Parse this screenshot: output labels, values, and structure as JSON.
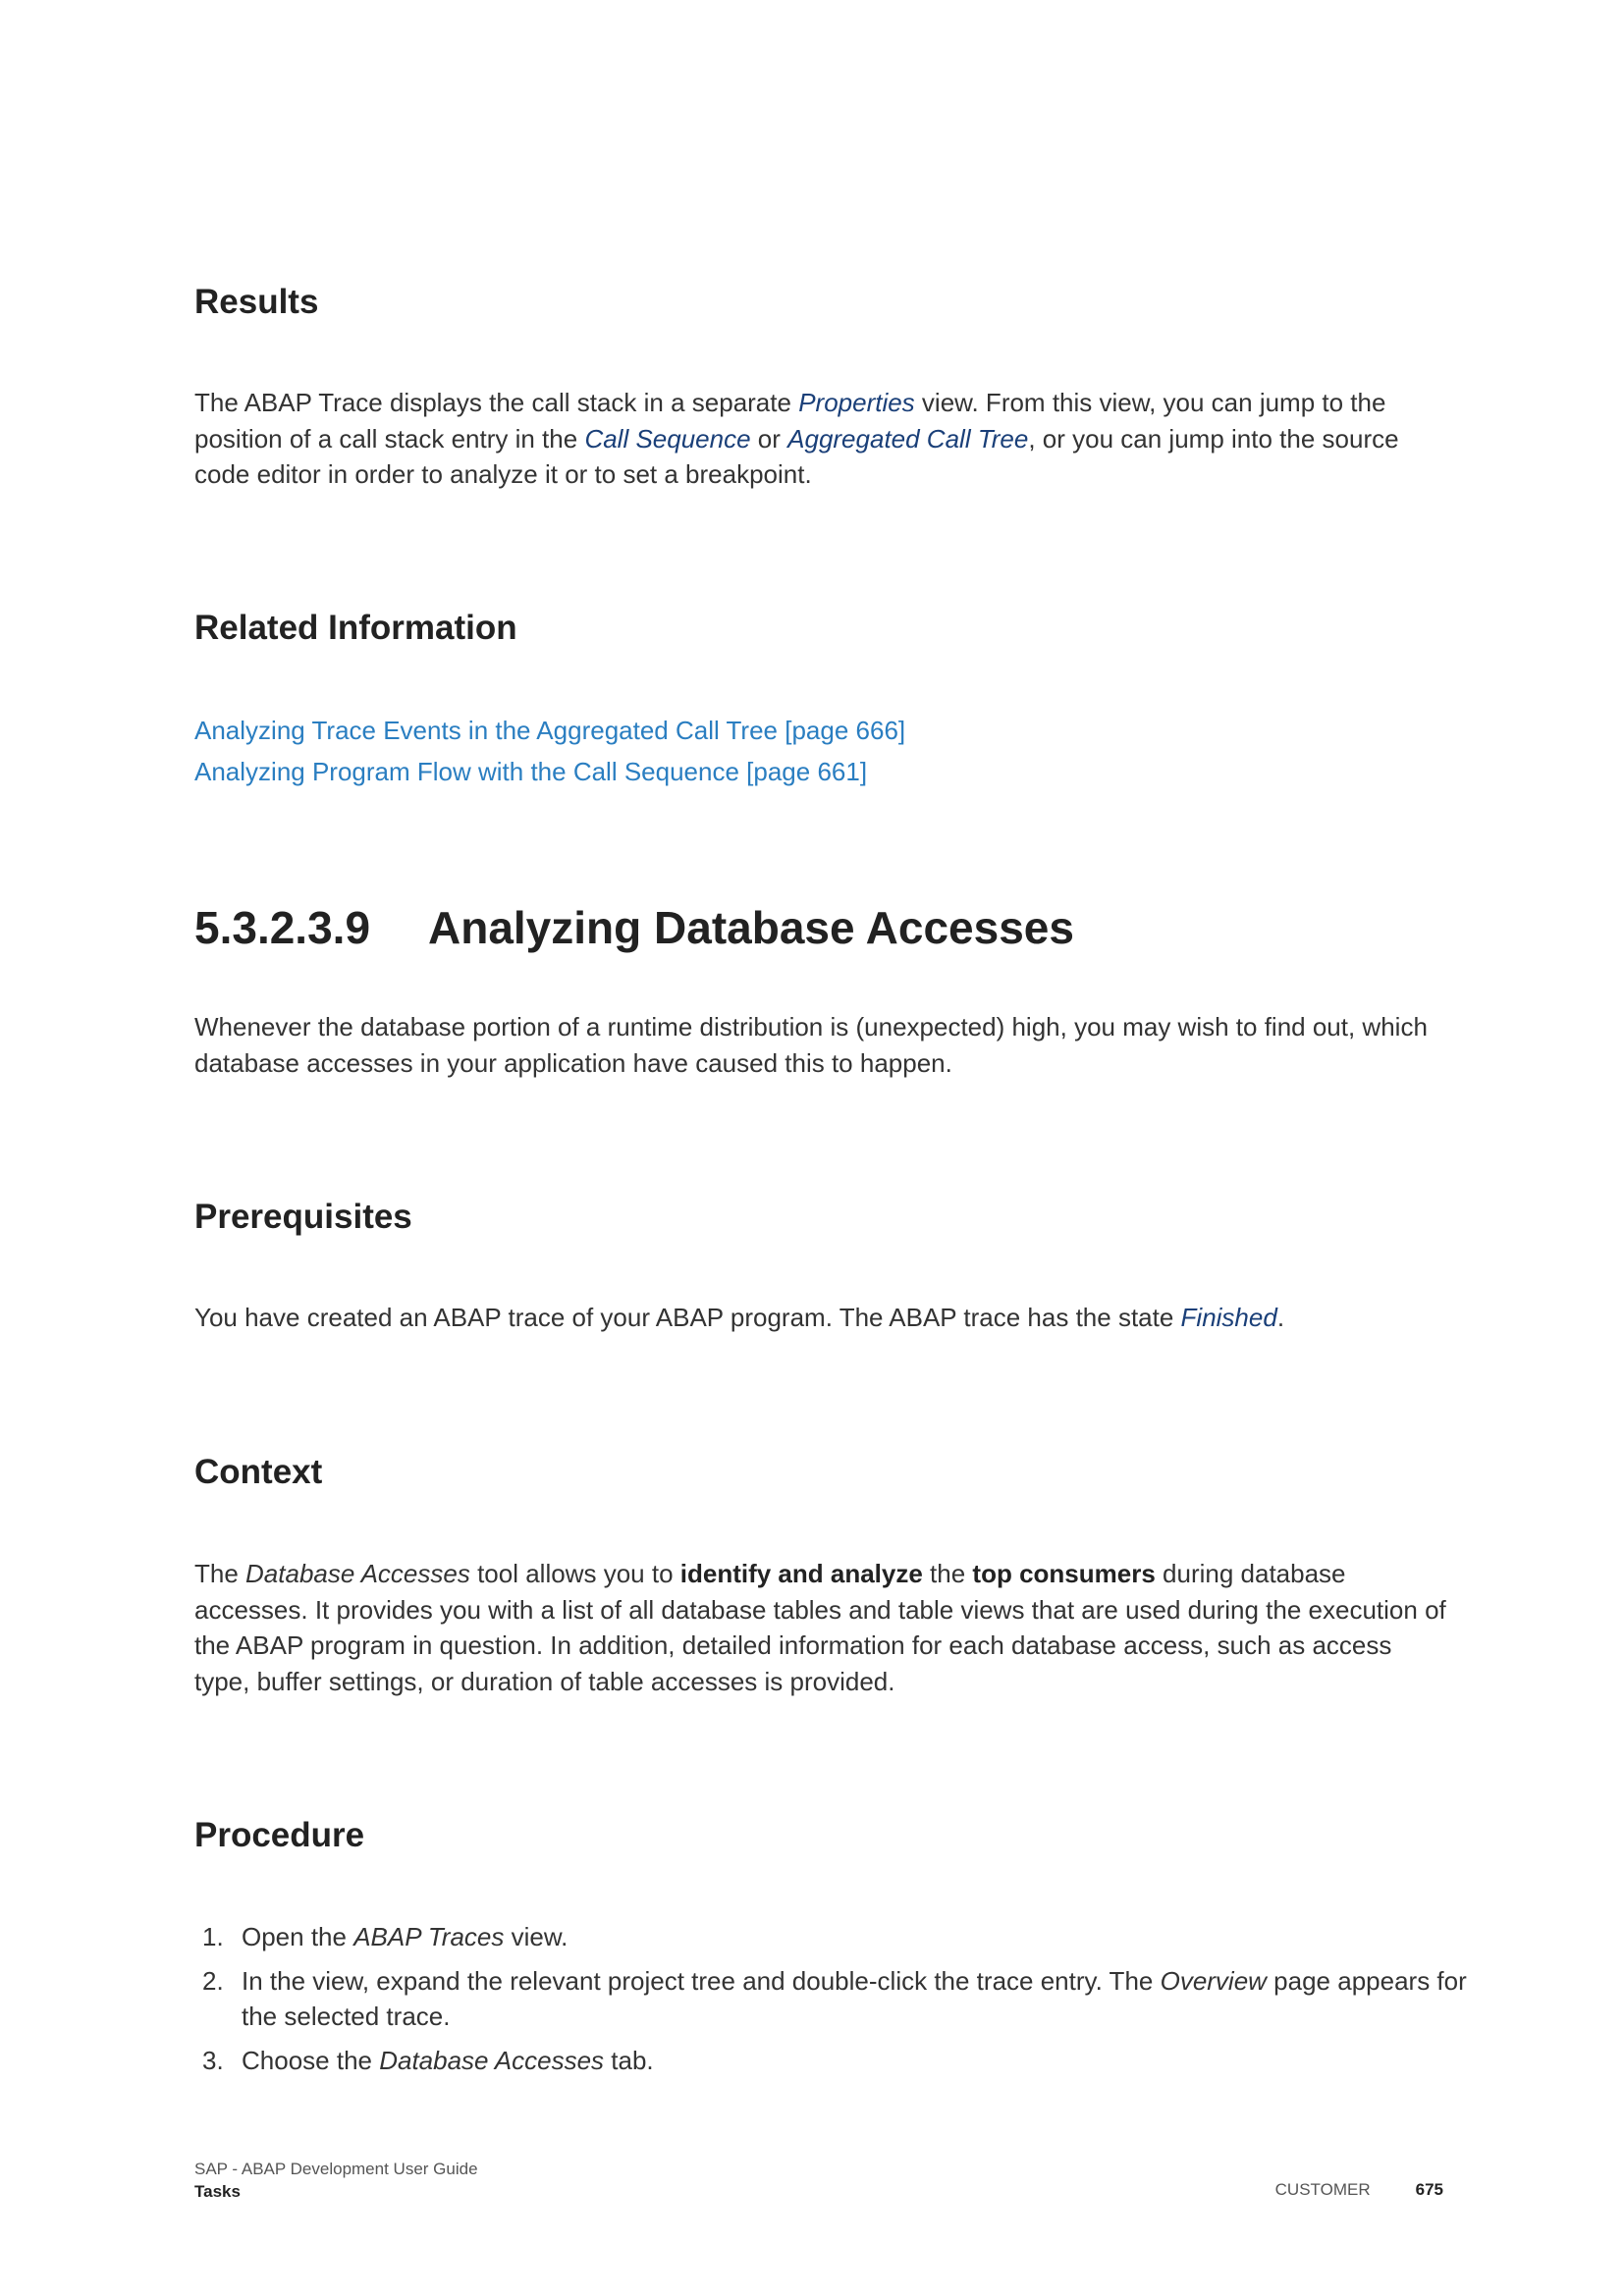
{
  "results": {
    "heading": "Results",
    "para": {
      "t1": "The ABAP Trace displays the call stack in a separate ",
      "i1": "Properties",
      "t2": " view. From this view, you can jump to the position of a call stack entry in the ",
      "i2": "Call Sequence",
      "t3": " or ",
      "i3": "Aggregated Call Tree",
      "t4": ", or you can jump into the source code editor in order to analyze it or to set a breakpoint."
    }
  },
  "related": {
    "heading": "Related Information",
    "links": [
      "Analyzing Trace Events in the Aggregated Call Tree [page 666]",
      "Analyzing Program Flow with the Call Sequence [page 661]"
    ]
  },
  "section": {
    "number": "5.3.2.3.9",
    "title": "Analyzing Database Accesses",
    "intro": "Whenever the database portion of a runtime distribution is (unexpected) high, you may wish to find out, which database accesses in your application have caused this to happen."
  },
  "prereq": {
    "heading": "Prerequisites",
    "t1": "You have created an ABAP trace of your ABAP program. The ABAP trace has the state ",
    "i1": "Finished",
    "t2": "."
  },
  "context": {
    "heading": "Context",
    "t1": "The ",
    "i1": "Database Accesses",
    "t2": " tool allows you to ",
    "b1": "identify and analyze",
    "t3": " the ",
    "b2": "top consumers",
    "t4": " during database accesses. It provides you with a list of all database tables and table views that are used during the execution of the ABAP program in question. In addition, detailed information for each database access, such as access type, buffer settings, or duration of table accesses is provided."
  },
  "procedure": {
    "heading": "Procedure",
    "steps": [
      {
        "num": "1.",
        "t1": "Open the ",
        "i1": "ABAP Traces",
        "t2": " view."
      },
      {
        "num": "2.",
        "t1": "In the view, expand the relevant project tree and double-click the trace entry. The ",
        "i1": "Overview",
        "t2": " page appears for the selected trace."
      },
      {
        "num": "3.",
        "t1": "Choose the ",
        "i1": "Database Accesses",
        "t2": " tab."
      }
    ]
  },
  "footer": {
    "doc_title": "SAP - ABAP Development User Guide",
    "chapter": "Tasks",
    "classification": "CUSTOMER",
    "page": "675"
  }
}
